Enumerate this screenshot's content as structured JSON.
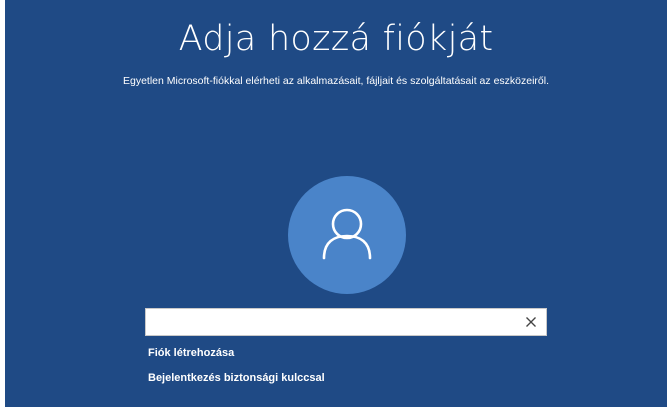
{
  "page": {
    "title": "Adja hozzá fiókját",
    "subtitle": "Egyetlen Microsoft-fiókkal elérheti az alkalmazásait, fájljait és szolgáltatásait az eszközeiről."
  },
  "account_input": {
    "value": "",
    "placeholder": ""
  },
  "icons": {
    "avatar": "user-icon",
    "clear": "close-icon"
  },
  "links": {
    "create_account": "Fiók létrehozása",
    "security_key": "Bejelentkezés biztonsági kulccsal"
  },
  "colors": {
    "background": "#1f4a85",
    "avatar_circle": "#4a84c9",
    "text": "#ffffff"
  }
}
